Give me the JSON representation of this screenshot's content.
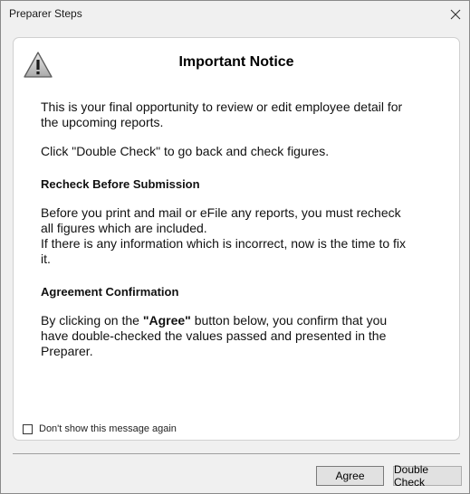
{
  "window": {
    "title": "Preparer Steps"
  },
  "notice": {
    "heading": "Important Notice",
    "intro_line1": "This is your final opportunity to review or edit employee detail for",
    "intro_line2": "the upcoming reports.",
    "click_hint": "Click \"Double Check\" to go back and check figures.",
    "recheck_title": "Recheck Before Submission",
    "recheck_line1": "Before you print and mail or eFile any reports, you must recheck",
    "recheck_line2": "all figures which are included.",
    "recheck_line3": "If there is any information which is incorrect, now is the time to fix",
    "recheck_line4": "it.",
    "agreement_title": "Agreement Confirmation",
    "agreement_pre": "By clicking on the ",
    "agreement_bold": "\"Agree\"",
    "agreement_post": " button below, you confirm that you",
    "agreement_line2": "have double-checked the values passed and presented in the",
    "agreement_line3": "Preparer."
  },
  "options": {
    "dont_show_label": "Don't show this message again",
    "dont_show_checked": false
  },
  "buttons": {
    "agree": "Agree",
    "double_check": "Double Check"
  },
  "icons": {
    "warning": "warning-triangle-icon",
    "close": "close-icon"
  }
}
